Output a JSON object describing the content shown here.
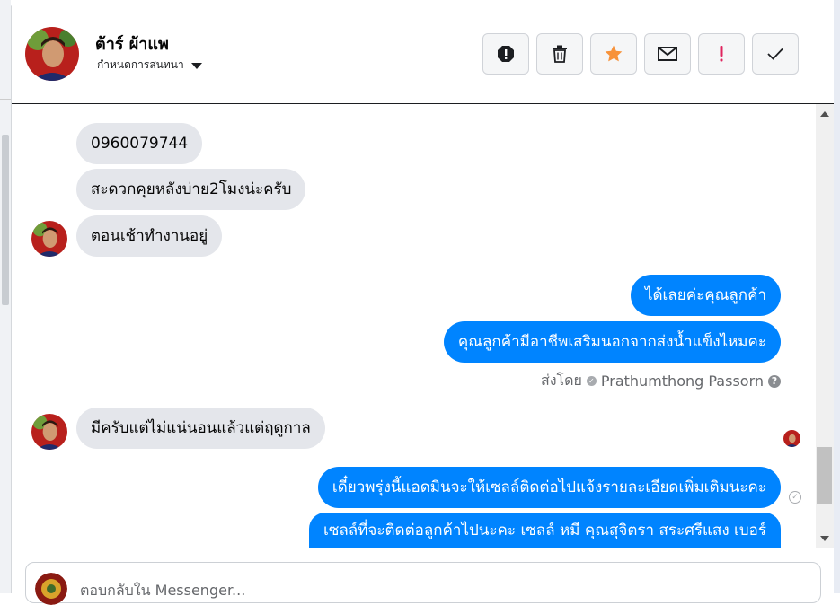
{
  "header": {
    "contact_name": "ต้าร์ ผ้าแพ",
    "subtitle": "กำหนดการสนทนา",
    "toolbar": [
      {
        "name": "spam-button",
        "icon": "exclamation-octagon-icon"
      },
      {
        "name": "delete-button",
        "icon": "trash-icon"
      },
      {
        "name": "star-button",
        "icon": "star-icon",
        "color": "#f7923a"
      },
      {
        "name": "mark-unread-button",
        "icon": "envelope-icon"
      },
      {
        "name": "follow-up-button",
        "icon": "exclamation-icon",
        "color": "#e0245e"
      },
      {
        "name": "mark-done-button",
        "icon": "check-icon"
      }
    ]
  },
  "messages": [
    {
      "direction": "incoming",
      "text": "0960079744"
    },
    {
      "direction": "incoming",
      "text": "สะดวกคุยหลังบ่าย2โมงน่ะครับ"
    },
    {
      "direction": "incoming",
      "text": "ตอนเช้าทำงานอยู่"
    },
    {
      "direction": "outgoing",
      "text": "ได้เลยค่ะคุณลูกค้า"
    },
    {
      "direction": "outgoing",
      "text": "คุณลูกค้ามีอาชีพเสริมนอกจากส่งน้ำแข็งไหมคะ"
    },
    {
      "direction": "incoming",
      "text": "มีครับแต่ไม่แน่นอนแล้วแต่ฤดูกาล"
    },
    {
      "direction": "outgoing",
      "text": "เดี๋ยวพรุ่งนี้แอดมินจะให้เซลล์ติดต่อไปแจ้งรายละเอียดเพิ่มเติมนะคะ"
    },
    {
      "direction": "outgoing",
      "text": "เซลล์ที่จะติดต่อลูกค้าไปนะคะ เซลล์ หมี คุณสุจิตรา สระศรีแสง เบอร์"
    }
  ],
  "sent_by": {
    "prefix": "ส่งโดย",
    "agent": "Prathumthong Passorn"
  },
  "composer": {
    "placeholder": "ตอบกลับใน Messenger..."
  },
  "colors": {
    "outgoing_bubble": "#0084ff",
    "incoming_bubble": "#e4e6eb"
  }
}
